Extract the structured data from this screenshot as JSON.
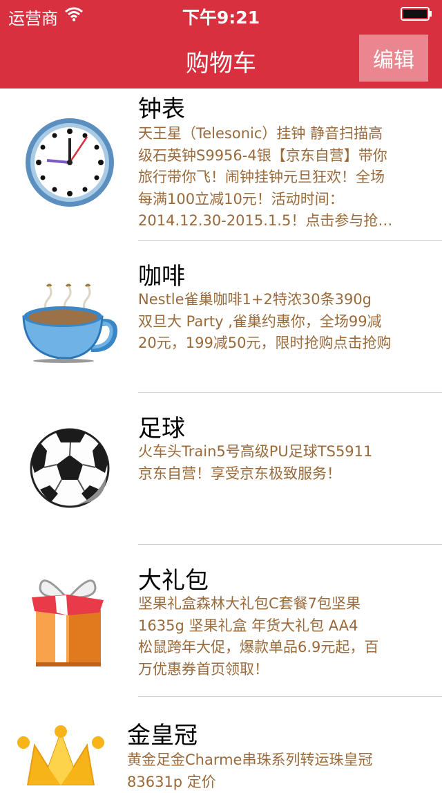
{
  "status_bar": {
    "carrier": "运营商",
    "time": "下午9:21"
  },
  "nav": {
    "title": "购物车",
    "edit_label": "编辑"
  },
  "items": [
    {
      "title": "钟表",
      "icon": "clock-icon",
      "description": "天王星（Telesonic）挂钟 静音扫描高\n级石英钟S9956-4银【京东自营】带你\n旅行带你飞！闹钟挂钟元旦狂欢！全场\n每满100立减10元！活动时间：\n2014.12.30-2015.1.5！点击参与抢…"
    },
    {
      "title": "咖啡",
      "icon": "coffee-cup-icon",
      "description": "Nestle雀巢咖啡1+2特浓30条390g\n双旦大 Party ,雀巢约惠你，全场99减\n20元，199减50元，限时抢购点击抢购"
    },
    {
      "title": "足球",
      "icon": "soccer-ball-icon",
      "description": "火车头Train5号高级PU足球TS5911\n京东自营！享受京东极致服务！"
    },
    {
      "title": "大礼包",
      "icon": "gift-box-icon",
      "description": "坚果礼盒森林大礼包C套餐7包坚果\n1635g 坚果礼盒 年货大礼包 AA4\n松鼠跨年大促，爆款单品6.9元起，百\n万优惠券首页领取！"
    },
    {
      "title": "金皇冠",
      "icon": "crown-icon",
      "description": "黄金足金Charme串珠系列转运珠皇冠\n83631p 定价"
    }
  ]
}
